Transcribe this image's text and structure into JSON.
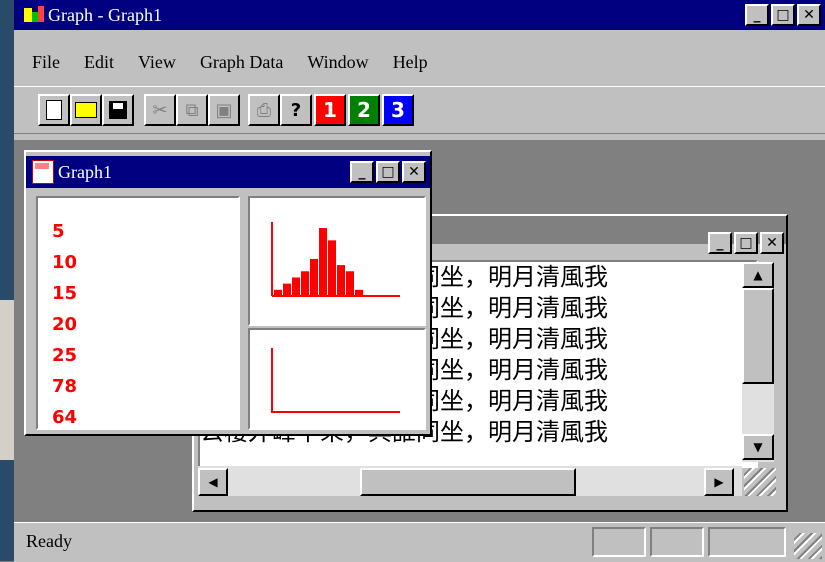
{
  "app": {
    "title": "Graph - Graph1"
  },
  "menu": [
    "File",
    "Edit",
    "View",
    "Graph Data",
    "Window",
    "Help"
  ],
  "toolbar": {
    "new_icon": "new-document-icon",
    "open_icon": "open-folder-icon",
    "save_icon": "save-disk-icon",
    "cut_icon": "scissors-icon",
    "copy_icon": "copy-icon",
    "paste_icon": "paste-icon",
    "print_icon": "printer-icon",
    "help_icon": "help-question-icon",
    "graph_buttons": [
      {
        "label": "1",
        "color": "#ff0000"
      },
      {
        "label": "2",
        "color": "#008000"
      },
      {
        "label": "3",
        "color": "#0000ff"
      }
    ]
  },
  "graph_window": {
    "title": "Graph1",
    "values": [
      "5",
      "10",
      "15",
      "20",
      "25",
      "78",
      "64"
    ]
  },
  "text_window": {
    "lines": [
      "公樓外峰千朵，與誰同坐，明月清風我",
      "公樓外峰千朵，與誰同坐，明月清風我",
      "公樓外峰千朵，與誰同坐，明月清風我",
      "公樓外峰千朵，與誰同坐，明月清風我",
      "公樓外峰千朵，與誰同坐，明月清風我",
      "公樓外峰千朵，與誰同坐，明月清風我"
    ]
  },
  "status": {
    "text": "Ready"
  },
  "colors": {
    "titlebar": "#000080",
    "chart": "#ff0000",
    "face": "#c0c0c0"
  },
  "chart_data": [
    {
      "type": "bar",
      "values": [
        1,
        2,
        3,
        4,
        6,
        11,
        9,
        5,
        4,
        1
      ]
    },
    {
      "type": "line",
      "values": []
    }
  ]
}
